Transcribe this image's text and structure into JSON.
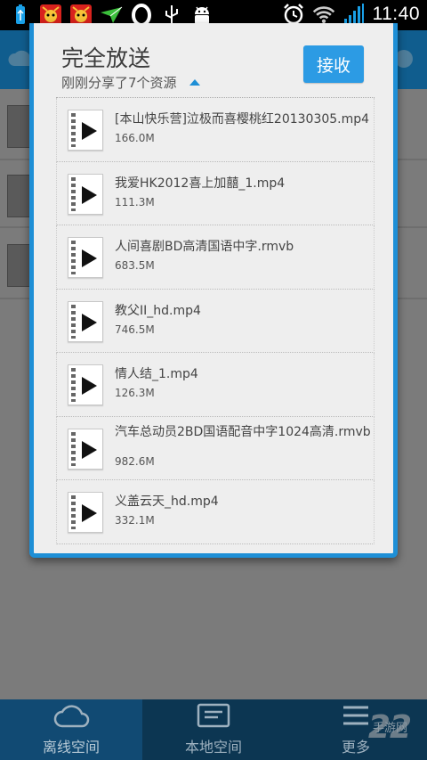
{
  "status_bar": {
    "time": "11:40",
    "icons": [
      "usb-icon",
      "app-icon",
      "app-icon",
      "send-icon",
      "opera-icon",
      "usb-debug-icon",
      "android-icon",
      "alarm-icon",
      "wifi-icon",
      "signal-icon",
      "battery-icon"
    ],
    "battery_color": "#19a0e8"
  },
  "dialog": {
    "title": "完全放送",
    "subtitle": "刚刚分享了7个资源",
    "accept_label": "接收",
    "accent_color": "#1e8fd6",
    "files": [
      {
        "name": "[本山快乐营]泣极而喜樱桃红20130305.mp4",
        "size": "166.0M"
      },
      {
        "name": "我爱HK2012喜上加囍_1.mp4",
        "size": "111.3M"
      },
      {
        "name": "人间喜剧BD高清国语中字.rmvb",
        "size": "683.5M"
      },
      {
        "name": "教父II_hd.mp4",
        "size": "746.5M"
      },
      {
        "name": "情人结_1.mp4",
        "size": "126.3M"
      },
      {
        "name": "汽车总动员2BD国语配音中字1024高清.rmvb",
        "size": "982.6M"
      },
      {
        "name": "义盖云天_hd.mp4",
        "size": "332.1M"
      }
    ]
  },
  "bottom_nav": {
    "items": [
      {
        "label": "离线空间",
        "icon": "cloud-icon",
        "active": true
      },
      {
        "label": "本地空间",
        "icon": "local-icon",
        "active": false
      },
      {
        "label": "更多",
        "icon": "menu-icon",
        "active": false
      }
    ]
  },
  "watermark": {
    "text": "22",
    "sub": "手游网"
  }
}
